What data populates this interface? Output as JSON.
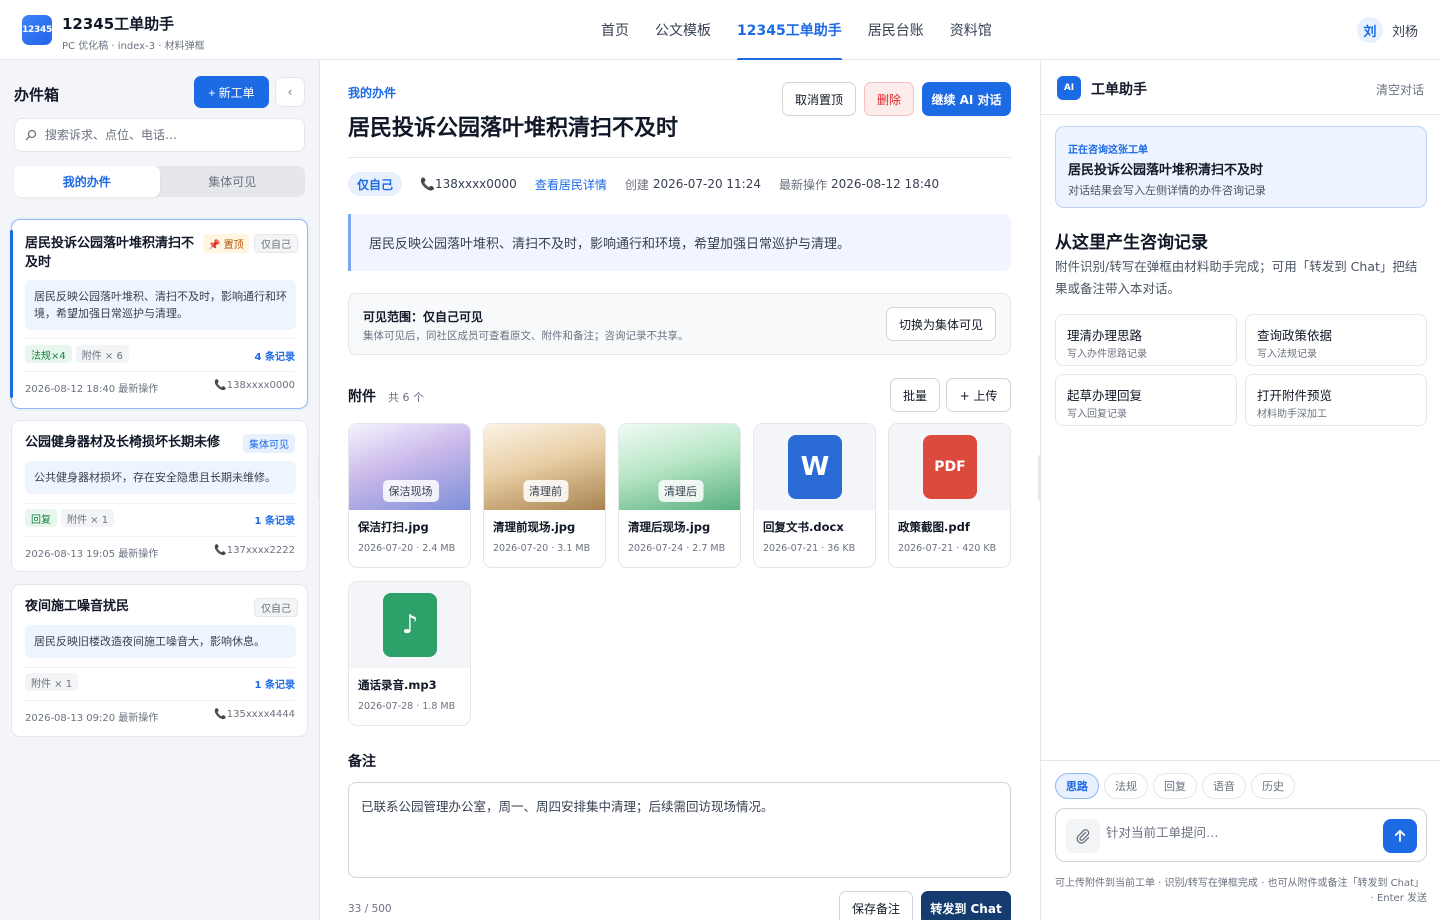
{
  "app": {
    "logo_text": "12345",
    "title": "12345工单助手",
    "subtitle": "PC 优化稿 · index-3 · 材料弹框",
    "accent": "#1d6ae5"
  },
  "nav": {
    "items": [
      "首页",
      "公文模板",
      "12345工单助手",
      "居民台账",
      "资料馆"
    ],
    "active_index": 2
  },
  "user": {
    "avatar": "刘",
    "name": "刘杨"
  },
  "inbox": {
    "title": "办件箱",
    "new_label": "+ 新工单",
    "collapse_icon": "‹",
    "search_placeholder": "搜索诉求、点位、电话…",
    "tabs": [
      "我的办件",
      "集体可见"
    ],
    "cards": [
      {
        "title_line1": "居民投诉公园落叶堆积清扫不",
        "title_line2": "及时",
        "pin": "📌 置顶",
        "visibility": "仅自己",
        "desc": "居民反映公园落叶堆积、清扫不及时，影响通行和环境，希望加强日常巡护与清理。",
        "tags": [
          "法规×4",
          "附件 × 6"
        ],
        "count": "4 条记录",
        "time": "2026-08-12 18:40 最新操作",
        "phone": "📞138xxxx0000"
      },
      {
        "title_line1": "公园健身器材及长椅损坏长期未修",
        "visibility": "集体可见",
        "desc": "公共健身器材损坏，存在安全隐患且长期未维修。",
        "tags": [
          "回复",
          "附件 × 1"
        ],
        "count": "1 条记录",
        "time": "2026-08-13 19:05 最新操作",
        "phone": "📞137xxxx2222"
      },
      {
        "title_line1": "夜间施工噪音扰民",
        "visibility": "仅自己",
        "desc": "居民反映旧楼改造夜间施工噪音大，影响休息。",
        "tags": [
          "附件 × 1"
        ],
        "count": "1 条记录",
        "time": "2026-08-13 09:20 最新操作",
        "phone": "📞135xxxx4444"
      }
    ]
  },
  "detail": {
    "crumb": "我的办件",
    "title": "居民投诉公园落叶堆积清扫不及时",
    "actions": {
      "unpin": "取消置顶",
      "delete": "删除",
      "continue": "继续 AI 对话"
    },
    "meta": {
      "scope_pill": "仅自己",
      "phone": "📞138xxxx0000",
      "resident_link": "查看居民详情",
      "created_label": "创建",
      "created": "2026-07-20 11:24",
      "updated_label": "最新操作",
      "updated": "2026-08-12 18:40"
    },
    "summary": "居民反映公园落叶堆积、清扫不及时，影响通行和环境，希望加强日常巡护与清理。",
    "scope": {
      "title": "可见范围：仅自己可见",
      "desc": "集体可见后，同社区成员可查看原文、附件和备注；咨询记录不共享。",
      "switch_label": "切换为集体可见"
    },
    "attachments": {
      "title": "附件",
      "count": "共 6 个",
      "batch_label": "批量",
      "upload_label": "+ 上传",
      "items": [
        {
          "thumb_label": "保洁现场",
          "name": "保洁打扫.jpg",
          "meta": "2026-07-20 · 2.4 MB",
          "kind": "photo-violet"
        },
        {
          "thumb_label": "清理前",
          "name": "清理前现场.jpg",
          "meta": "2026-07-20 · 3.1 MB",
          "kind": "photo-brown"
        },
        {
          "thumb_label": "清理后",
          "name": "清理后现场.jpg",
          "meta": "2026-07-24 · 2.7 MB",
          "kind": "photo-green"
        },
        {
          "icon_text": "W",
          "name": "回复文书.docx",
          "meta": "2026-07-21 · 36 KB",
          "kind": "word",
          "color": "#2b6bd6"
        },
        {
          "icon_text": "PDF",
          "name": "政策截图.pdf",
          "meta": "2026-07-21 · 420 KB",
          "kind": "pdf",
          "color": "#dc4a3d"
        },
        {
          "icon_text": "♪",
          "name": "通话录音.mp3",
          "meta": "2026-07-28 · 1.8 MB",
          "kind": "audio",
          "color": "#2ea06a"
        }
      ]
    },
    "notes": {
      "title": "备注",
      "value": "已联系公园管理办公室，周一、周四安排集中清理；后续需回访现场情况。",
      "counter": "33 / 500",
      "save_label": "保存备注",
      "forward_label": "转发到 Chat"
    }
  },
  "assistant": {
    "badge": "AI",
    "title": "工单助手",
    "clear_label": "清空对话",
    "context": {
      "label": "正在咨询这张工单",
      "title": "居民投诉公园落叶堆积清扫不及时",
      "desc": "对话结果会写入左侧详情的办件咨询记录"
    },
    "heading": "从这里产生咨询记录",
    "description": "附件识别/转写在弹框由材料助手完成；可用「转发到 Chat」把结果或备注带入本对话。",
    "quick_actions": [
      {
        "title": "理清办理思路",
        "sub": "写入办件思路记录"
      },
      {
        "title": "查询政策依据",
        "sub": "写入法规记录"
      },
      {
        "title": "起草办理回复",
        "sub": "写入回复记录"
      },
      {
        "title": "打开附件预览",
        "sub": "材料助手深加工"
      }
    ],
    "tabs": [
      "思路",
      "法规",
      "回复",
      "语音",
      "历史"
    ],
    "input_placeholder": "针对当前工单提问…",
    "hint_line1": "可上传附件到当前工单 · 识别/转写在弹框完成 · 也可从附件或备注「转发到 Chat」",
    "hint_line2": "· Enter 发送"
  }
}
